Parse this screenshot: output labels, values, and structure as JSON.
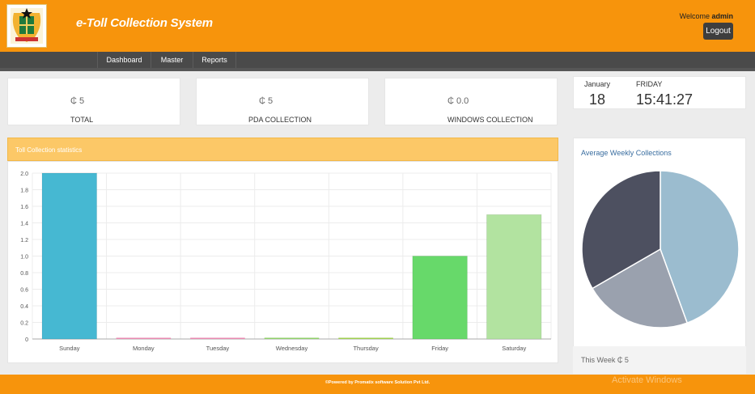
{
  "header": {
    "app_title": "e-Toll Collection System",
    "welcome_text": "Welcome",
    "user_name": "admin",
    "logout_label": "Logout"
  },
  "nav": {
    "items": [
      {
        "label": "Dashboard"
      },
      {
        "label": "Master"
      },
      {
        "label": "Reports"
      }
    ]
  },
  "stats": [
    {
      "value": "₵ 5",
      "label": "TOTAL"
    },
    {
      "value": "₵ 5",
      "label": "PDA COLLECTION"
    },
    {
      "value": "₵ 0.0",
      "label": "WINDOWS COLLECTION"
    }
  ],
  "datetime": {
    "month": "January",
    "day": "18",
    "weekday": "FRIDAY",
    "time": "15:41:27"
  },
  "chart_title": "Toll Collection statistics",
  "chart_data": [
    {
      "type": "bar",
      "categories": [
        "Sunday",
        "Monday",
        "Tuesday",
        "Wednesday",
        "Thursday",
        "Friday",
        "Saturday"
      ],
      "values": [
        2.0,
        0,
        0,
        0,
        0,
        1.0,
        1.5
      ],
      "colors": [
        "#46b8d2",
        "#e98ab0",
        "#e98ab0",
        "#8fcf6a",
        "#9fcf50",
        "#67d96a",
        "#b2e3a0"
      ],
      "ylim": [
        0,
        2.0
      ],
      "yticks": [
        "0",
        "0.2",
        "0.4",
        "0.6",
        "0.8",
        "1.0",
        "1.2",
        "1.4",
        "1.6",
        "1.8",
        "2.0"
      ],
      "grid": true
    },
    {
      "type": "pie",
      "title": "Average Weekly Collections",
      "values": [
        2.0,
        1.0,
        1.5
      ],
      "colors": [
        "#9bbccf",
        "#9aa1ae",
        "#4d5060"
      ]
    }
  ],
  "week_total": "This Week ₵ 5",
  "footer_text": "©Powered by Promatix software Solution Pvt Ltd.",
  "watermark": "Activate Windows"
}
